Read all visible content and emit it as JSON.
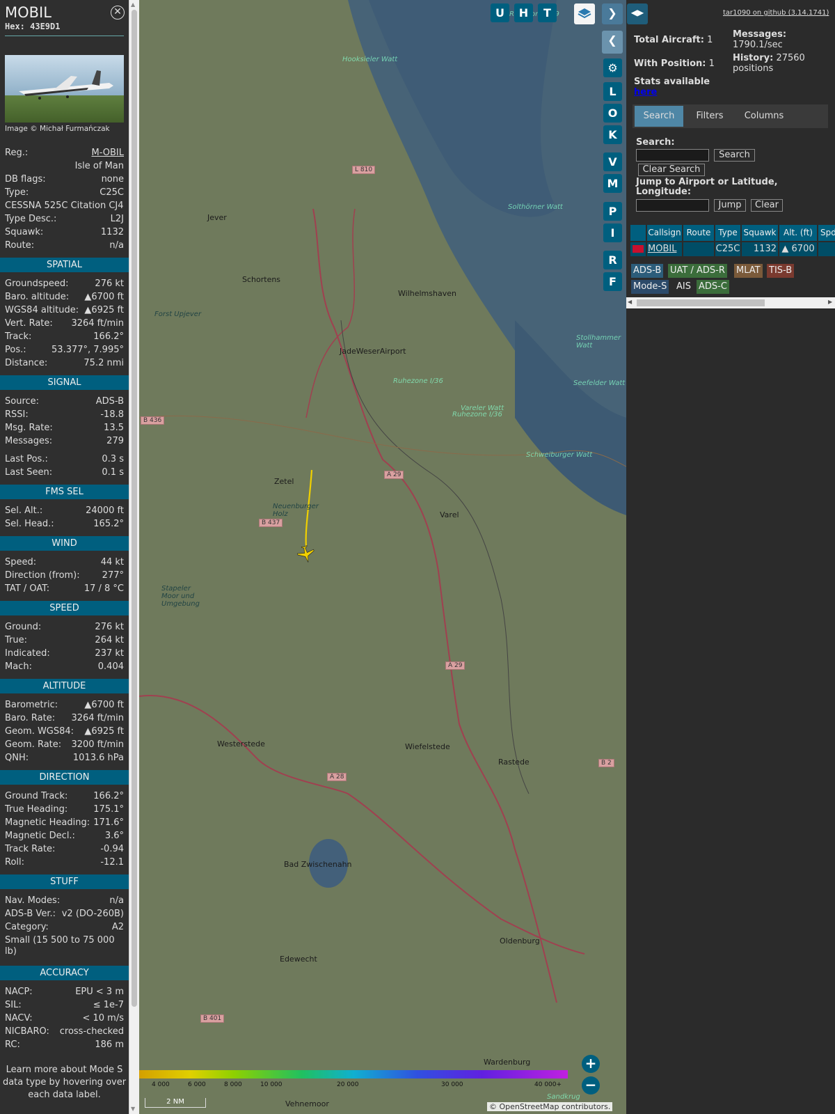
{
  "sidebar": {
    "callsign": "MOBIL",
    "hex": "Hex: 43E9D1",
    "photo_credit": "Image © Michał Furmańczak",
    "rows": [
      {
        "k": "Reg.:",
        "v": "M-OBIL",
        "link": true
      },
      {
        "k": "",
        "v": "Isle of Man"
      },
      {
        "k": "DB flags:",
        "v": "none"
      },
      {
        "k": "Type:",
        "v": "C25C"
      },
      {
        "k": "CESSNA 525C Citation CJ4",
        "v": ""
      },
      {
        "k": "Type Desc.:",
        "v": "L2J"
      },
      {
        "k": "Squawk:",
        "v": "1132"
      },
      {
        "k": "Route:",
        "v": "n/a"
      }
    ],
    "sections": [
      {
        "title": "SPATIAL",
        "rows": [
          {
            "k": "Groundspeed:",
            "v": "276 kt"
          },
          {
            "k": "Baro. altitude:",
            "v": "▲6700 ft"
          },
          {
            "k": "WGS84 altitude:",
            "v": "▲6925 ft"
          },
          {
            "k": "Vert. Rate:",
            "v": "3264 ft/min"
          },
          {
            "k": "Track:",
            "v": "166.2°"
          },
          {
            "k": "Pos.:",
            "v": "53.377°, 7.995°"
          },
          {
            "k": "Distance:",
            "v": "75.2 nmi"
          }
        ]
      },
      {
        "title": "SIGNAL",
        "rows": [
          {
            "k": "Source:",
            "v": "ADS-B"
          },
          {
            "k": "RSSI:",
            "v": "-18.8"
          },
          {
            "k": "Msg. Rate:",
            "v": "13.5"
          },
          {
            "k": "Messages:",
            "v": "279"
          },
          {
            "k": "Last Pos.:",
            "v": "0.3 s",
            "gap": true
          },
          {
            "k": "Last Seen:",
            "v": "0.1 s"
          }
        ]
      },
      {
        "title": "FMS SEL",
        "rows": [
          {
            "k": "Sel. Alt.:",
            "v": "24000 ft"
          },
          {
            "k": "Sel. Head.:",
            "v": "165.2°"
          }
        ]
      },
      {
        "title": "WIND",
        "rows": [
          {
            "k": "Speed:",
            "v": "44 kt"
          },
          {
            "k": "Direction (from):",
            "v": "277°"
          },
          {
            "k": "TAT / OAT:",
            "v": "17 / 8 °C"
          }
        ]
      },
      {
        "title": "SPEED",
        "rows": [
          {
            "k": "Ground:",
            "v": "276 kt"
          },
          {
            "k": "True:",
            "v": "264 kt"
          },
          {
            "k": "Indicated:",
            "v": "237 kt"
          },
          {
            "k": "Mach:",
            "v": "0.404"
          }
        ]
      },
      {
        "title": "ALTITUDE",
        "rows": [
          {
            "k": "Barometric:",
            "v": "▲6700 ft"
          },
          {
            "k": "Baro. Rate:",
            "v": "3264 ft/min"
          },
          {
            "k": "Geom. WGS84:",
            "v": "▲6925 ft"
          },
          {
            "k": "Geom. Rate:",
            "v": "3200 ft/min"
          },
          {
            "k": "QNH:",
            "v": "1013.6 hPa"
          }
        ]
      },
      {
        "title": "DIRECTION",
        "rows": [
          {
            "k": "Ground Track:",
            "v": "166.2°"
          },
          {
            "k": "True Heading:",
            "v": "175.1°"
          },
          {
            "k": "Magnetic Heading:",
            "v": "171.6°"
          },
          {
            "k": "Magnetic Decl.:",
            "v": "3.6°"
          },
          {
            "k": "Track Rate:",
            "v": "-0.94"
          },
          {
            "k": "Roll:",
            "v": "-12.1"
          }
        ]
      },
      {
        "title": "STUFF",
        "rows": [
          {
            "k": "Nav. Modes:",
            "v": "n/a"
          },
          {
            "k": "ADS-B Ver.:",
            "v": "v2 (DO-260B)"
          },
          {
            "k": "Category:",
            "v": "A2"
          },
          {
            "k": "Small (15 500 to 75 000 lb)",
            "v": "",
            "tall": true
          }
        ]
      },
      {
        "title": "ACCURACY",
        "rows": [
          {
            "k": "NACP:",
            "v": "EPU < 3 m"
          },
          {
            "k": "SIL:",
            "v": "≤ 1e-7"
          },
          {
            "k": "NACV:",
            "v": "< 10 m/s"
          },
          {
            "k": "NICBARO:",
            "v": "cross-checked"
          },
          {
            "k": "RC:",
            "v": "186 m"
          }
        ]
      }
    ],
    "footer_note": "Learn more about Mode S data type by hovering over each data label."
  },
  "map": {
    "places": [
      "Jever",
      "Schortens",
      "Wilhelmshaven",
      "Forst Upjever",
      "JadeWeserAirport",
      "Zetel",
      "Neuenburger Holz",
      "Varel",
      "Stapeler Moor und Umgebung",
      "Westerstede",
      "Wiefelstede",
      "Rastede",
      "Bad Zwischenahn",
      "Oldenburg",
      "Edewecht",
      "Wardenburg",
      "Vehnemoor",
      "Hooksieler Watt",
      "Ruhezone I/39",
      "Ruhezone I/36",
      "Vareler Watt",
      "Ruhezone I/36",
      "Schweiburger Watt",
      "Solthörner Watt",
      "Stollhammer Watt",
      "Seefelder Watt",
      "Sandkrug"
    ],
    "roads": [
      "L 810",
      "A 29",
      "B 436",
      "B 437",
      "A 29",
      "A 28",
      "B 401",
      "B 2"
    ],
    "scale_label": "2 NM",
    "legend_ticks": [
      "4 000",
      "6 000",
      "8 000",
      "10 000",
      "20 000",
      "30 000",
      "40 000+"
    ],
    "attribution": "© OpenStreetMap contributors.",
    "top_buttons": [
      "U",
      "H",
      "T"
    ],
    "side_buttons": [
      "L",
      "O",
      "K",
      "V",
      "M",
      "P",
      "I",
      "R",
      "F"
    ]
  },
  "panel": {
    "github": "tar1090 on github (3.14.1741)",
    "total_label": "Total Aircraft:",
    "total": "1",
    "withpos_label": "With Position:",
    "withpos": "1",
    "messages_label": "Messages:",
    "messages": "1790.1/sec",
    "history_label": "History:",
    "history": "27560 positions",
    "stats_label": "Stats available",
    "stats_link": "here",
    "tabs": [
      "Search",
      "Filters",
      "Columns"
    ],
    "search_label": "Search:",
    "search_btn": "Search",
    "clear_search_btn": "Clear Search",
    "jump_label": "Jump to Airport or Latitude, Longitude:",
    "jump_btn": "Jump",
    "clear_btn": "Clear",
    "columns": [
      "Callsign",
      "Route",
      "Type",
      "Squawk",
      "Alt. (ft)",
      "Spd"
    ],
    "row": {
      "callsign": "MOBIL",
      "route": "",
      "type": "C25C",
      "squawk": "1132",
      "alt": "▲ 6700"
    },
    "sources": [
      {
        "label": "ADS-B",
        "color": "#2c5d7a"
      },
      {
        "label": "UAT / ADS-R",
        "color": "#3b6d3b"
      },
      {
        "label": "MLAT",
        "color": "#7a5a3a"
      },
      {
        "label": "TIS-B",
        "color": "#7a3a2f"
      },
      {
        "label": "Mode-S",
        "color": "#2c4a6a"
      },
      {
        "label": "AIS",
        "color": "#2b2b2b"
      },
      {
        "label": "ADS-C",
        "color": "#3b6d3b"
      }
    ]
  }
}
